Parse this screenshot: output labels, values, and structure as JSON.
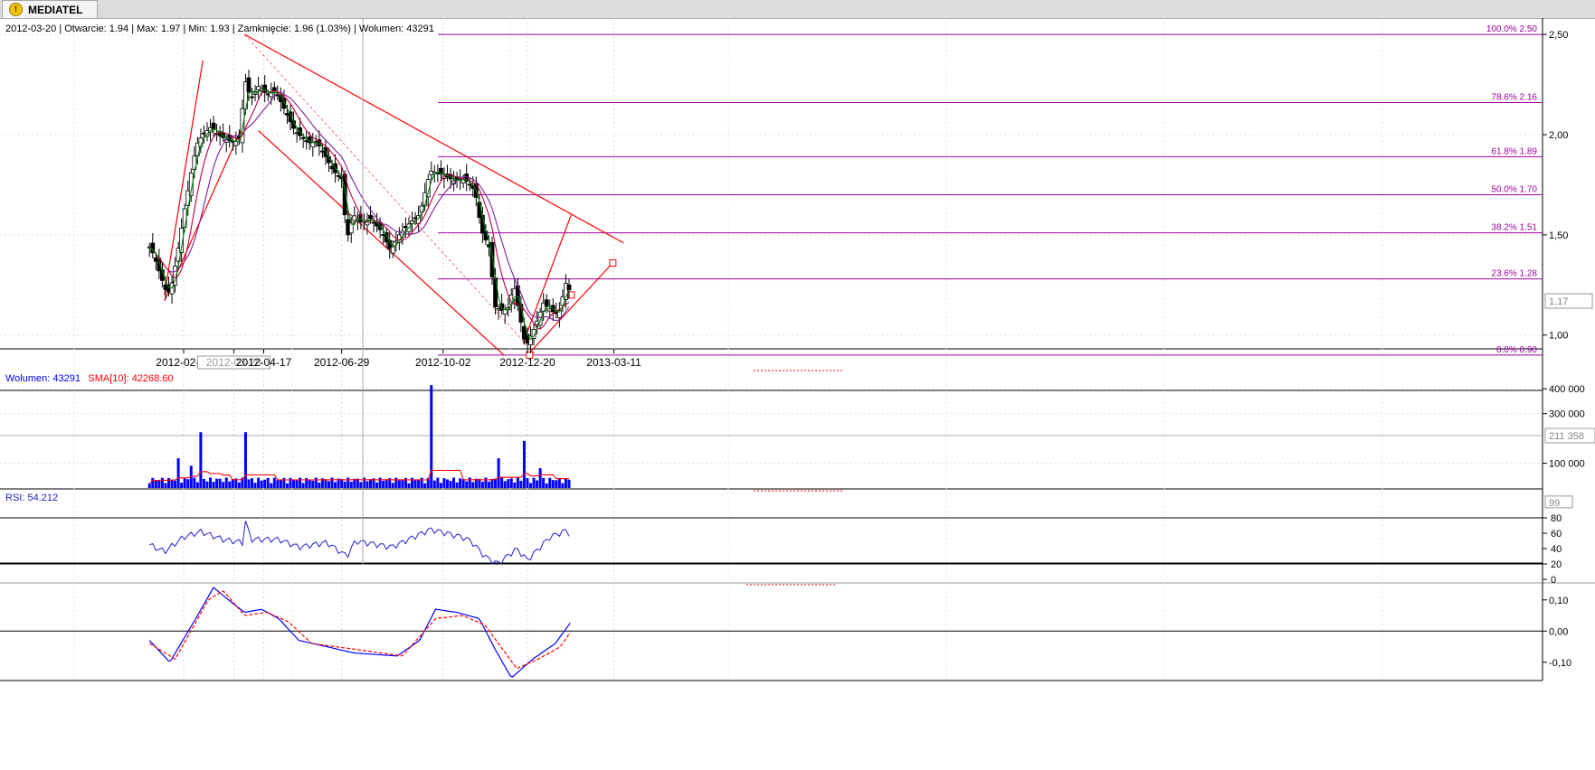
{
  "tab": {
    "icon": "warning-icon",
    "label": "MEDIATEL"
  },
  "info_bar": "2012-03-20 | Otwarcie: 1.94 | Max: 1.97 | Min: 1.93 | Zamknięcie: 1.96 (1.03%) | Wolumen: 43291",
  "colors": {
    "bull_candle": "#ffffff",
    "bear_candle": "#000000",
    "sma_fast": "#008000",
    "sma_mid": "#c00040",
    "sma_slow": "#7a1fa0",
    "fib_line": "#a000a0",
    "trend_line": "#ff0000",
    "volume_bar": "#0000ff",
    "rsi_line": "#2020d0",
    "macd_line": "#0000ff",
    "macd_signal": "#ff0000"
  },
  "chart_data": [
    {
      "type": "candlestick",
      "title": "MEDIATEL",
      "x_tick_labels": [
        "2012-02-02",
        "2012-03-20",
        "2012-04-17",
        "2012-06-29",
        "2012-10-02",
        "2012-12-20",
        "2013-03-11"
      ],
      "y_tick_labels": [
        "2,50",
        "2,00",
        "1,50",
        "1,00"
      ],
      "ylim": [
        0.85,
        2.55
      ],
      "current_price_label": "1,17",
      "crosshair_date": "2012-03-20",
      "fibonacci_levels": [
        {
          "label": "100.0% 2.50",
          "value": 2.5
        },
        {
          "label": "78.6% 2.16",
          "value": 2.16
        },
        {
          "label": "61.8% 1.89",
          "value": 1.89
        },
        {
          "label": "50.0% 1.70",
          "value": 1.7
        },
        {
          "label": "38.2% 1.51",
          "value": 1.51
        },
        {
          "label": "23.6% 1.28",
          "value": 1.28
        },
        {
          "label": "0.0% 0.90",
          "value": 0.9
        }
      ],
      "close_points": [
        [
          "2012-01-01",
          1.44
        ],
        [
          "2012-01-05",
          1.4
        ],
        [
          "2012-01-10",
          1.32
        ],
        [
          "2012-01-15",
          1.24
        ],
        [
          "2012-01-18",
          1.2
        ],
        [
          "2012-01-22",
          1.26
        ],
        [
          "2012-01-27",
          1.4
        ],
        [
          "2012-02-02",
          1.6
        ],
        [
          "2012-02-08",
          1.78
        ],
        [
          "2012-02-14",
          1.95
        ],
        [
          "2012-02-20",
          2.0
        ],
        [
          "2012-02-28",
          2.04
        ],
        [
          "2012-03-05",
          2.0
        ],
        [
          "2012-03-12",
          1.98
        ],
        [
          "2012-03-20",
          1.96
        ],
        [
          "2012-03-26",
          1.98
        ],
        [
          "2012-03-30",
          2.28
        ],
        [
          "2012-04-05",
          2.18
        ],
        [
          "2012-04-12",
          2.24
        ],
        [
          "2012-04-20",
          2.2
        ],
        [
          "2012-04-28",
          2.22
        ],
        [
          "2012-05-07",
          2.12
        ],
        [
          "2012-05-16",
          2.02
        ],
        [
          "2012-05-28",
          1.96
        ],
        [
          "2012-06-06",
          1.96
        ],
        [
          "2012-06-13",
          1.9
        ],
        [
          "2012-06-21",
          1.82
        ],
        [
          "2012-06-29",
          1.78
        ],
        [
          "2012-07-04",
          1.48
        ],
        [
          "2012-07-10",
          1.6
        ],
        [
          "2012-07-18",
          1.56
        ],
        [
          "2012-07-26",
          1.58
        ],
        [
          "2012-08-05",
          1.52
        ],
        [
          "2012-08-14",
          1.42
        ],
        [
          "2012-08-22",
          1.5
        ],
        [
          "2012-09-01",
          1.56
        ],
        [
          "2012-09-10",
          1.6
        ],
        [
          "2012-09-20",
          1.82
        ],
        [
          "2012-10-02",
          1.8
        ],
        [
          "2012-10-12",
          1.77
        ],
        [
          "2012-10-22",
          1.78
        ],
        [
          "2012-11-01",
          1.72
        ],
        [
          "2012-11-07",
          1.52
        ],
        [
          "2012-11-14",
          1.44
        ],
        [
          "2012-11-20",
          1.14
        ],
        [
          "2012-11-27",
          1.12
        ],
        [
          "2012-12-03",
          1.14
        ],
        [
          "2012-12-07",
          1.26
        ],
        [
          "2012-12-12",
          1.12
        ],
        [
          "2012-12-17",
          0.98
        ],
        [
          "2012-12-20",
          0.96
        ],
        [
          "2012-12-27",
          1.04
        ],
        [
          "2013-01-04",
          1.16
        ],
        [
          "2013-01-12",
          1.12
        ],
        [
          "2013-01-18",
          1.1
        ],
        [
          "2013-01-26",
          1.28
        ],
        [
          "2013-01-30",
          1.17
        ]
      ],
      "trend_lines": [
        {
          "name": "uptrend-channel-upper",
          "from": [
            "2012-01-15",
            1.2
          ],
          "to": [
            "2012-02-20",
            2.37
          ]
        },
        {
          "name": "uptrend-channel-lower",
          "from": [
            "2012-01-15",
            1.17
          ],
          "to": [
            "2012-03-28",
            2.04
          ]
        },
        {
          "name": "downtrend-upper",
          "from": [
            "2012-03-30",
            2.5
          ],
          "to": [
            "2013-03-20",
            1.46
          ]
        },
        {
          "name": "downtrend-lower",
          "from": [
            "2012-04-12",
            2.02
          ],
          "to": [
            "2012-11-28",
            0.9
          ]
        },
        {
          "name": "rebound-steep",
          "from": [
            "2012-12-16",
            0.96
          ],
          "to": [
            "2013-01-30",
            1.6
          ]
        },
        {
          "name": "rebound-shallow",
          "from": [
            "2012-12-20",
            0.9
          ],
          "to": [
            "2013-03-10",
            1.36
          ]
        }
      ]
    },
    {
      "type": "bar",
      "title": "Wolumen",
      "legend": [
        {
          "label": "Wolumen: 43291",
          "color": "#0000ff"
        },
        {
          "label": "SMA[10]: 42268.60",
          "color": "#ff0000"
        }
      ],
      "y_tick_labels": [
        "400 000",
        "300 000",
        "100 000"
      ],
      "ylim": [
        0,
        430000
      ],
      "current_value_label": "211 358",
      "spikes": [
        [
          "2012-01-27",
          120000
        ],
        [
          "2012-02-08",
          90000
        ],
        [
          "2012-02-18",
          225000
        ],
        [
          "2012-03-30",
          225000
        ],
        [
          "2012-09-20",
          415000
        ],
        [
          "2012-11-22",
          120000
        ],
        [
          "2012-12-17",
          190000
        ],
        [
          "2013-01-02",
          80000
        ]
      ],
      "typical_level": 30000,
      "sma10_level": 42268.6
    },
    {
      "type": "line",
      "title": "RSI",
      "legend": [
        {
          "label": "RSI: 54.212",
          "color": "#2020d0"
        }
      ],
      "y_tick_labels": [
        "80",
        "60",
        "40",
        "20",
        "0"
      ],
      "ylim": [
        0,
        100
      ],
      "reference_levels": [
        80,
        20
      ],
      "current_value_label": "99",
      "points": [
        [
          "2012-01-01",
          45
        ],
        [
          "2012-01-15",
          36
        ],
        [
          "2012-02-02",
          55
        ],
        [
          "2012-02-18",
          62
        ],
        [
          "2012-03-10",
          52
        ],
        [
          "2012-03-28",
          48
        ],
        [
          "2012-03-30",
          80
        ],
        [
          "2012-04-05",
          52
        ],
        [
          "2012-05-01",
          52
        ],
        [
          "2012-05-20",
          42
        ],
        [
          "2012-06-15",
          48
        ],
        [
          "2012-07-04",
          30
        ],
        [
          "2012-07-12",
          50
        ],
        [
          "2012-08-15",
          42
        ],
        [
          "2012-09-20",
          65
        ],
        [
          "2012-10-20",
          55
        ],
        [
          "2012-10-28",
          50
        ],
        [
          "2012-11-10",
          30
        ],
        [
          "2012-11-22",
          20
        ],
        [
          "2012-12-10",
          40
        ],
        [
          "2012-12-20",
          25
        ],
        [
          "2013-01-10",
          55
        ],
        [
          "2013-01-26",
          64
        ],
        [
          "2013-01-30",
          56
        ]
      ]
    },
    {
      "type": "line",
      "title": "MACD",
      "y_tick_labels": [
        "0,10",
        "0,00",
        "-0,10"
      ],
      "ylim": [
        -0.15,
        0.14
      ],
      "series": [
        {
          "points": [
            [
              "2012-01-01",
              -0.03
            ],
            [
              "2012-01-20",
              -0.1
            ],
            [
              "2012-02-15",
              0.05
            ],
            [
              "2012-03-01",
              0.14
            ],
            [
              "2012-03-15",
              0.1
            ],
            [
              "2012-03-30",
              0.06
            ],
            [
              "2012-04-15",
              0.07
            ],
            [
              "2012-05-01",
              0.04
            ],
            [
              "2012-05-20",
              -0.03
            ],
            [
              "2012-06-15",
              -0.05
            ],
            [
              "2012-07-10",
              -0.07
            ],
            [
              "2012-08-20",
              -0.08
            ],
            [
              "2012-09-10",
              -0.03
            ],
            [
              "2012-09-25",
              0.07
            ],
            [
              "2012-10-15",
              0.06
            ],
            [
              "2012-11-05",
              0.04
            ],
            [
              "2012-11-20",
              -0.06
            ],
            [
              "2012-12-05",
              -0.15
            ],
            [
              "2012-12-25",
              -0.09
            ],
            [
              "2013-01-15",
              -0.04
            ],
            [
              "2013-01-30",
              0.03
            ]
          ]
        },
        {
          "points": [
            [
              "2012-01-01",
              -0.04
            ],
            [
              "2012-01-25",
              -0.09
            ],
            [
              "2012-02-25",
              0.1
            ],
            [
              "2012-03-10",
              0.13
            ],
            [
              "2012-03-30",
              0.05
            ],
            [
              "2012-04-20",
              0.06
            ],
            [
              "2012-05-10",
              0.03
            ],
            [
              "2012-06-01",
              -0.04
            ],
            [
              "2012-07-15",
              -0.06
            ],
            [
              "2012-08-25",
              -0.08
            ],
            [
              "2012-09-25",
              0.04
            ],
            [
              "2012-10-20",
              0.05
            ],
            [
              "2012-11-10",
              0.02
            ],
            [
              "2012-12-10",
              -0.12
            ],
            [
              "2012-12-30",
              -0.09
            ],
            [
              "2013-01-20",
              -0.05
            ],
            [
              "2013-01-30",
              0.0
            ]
          ]
        }
      ]
    }
  ]
}
